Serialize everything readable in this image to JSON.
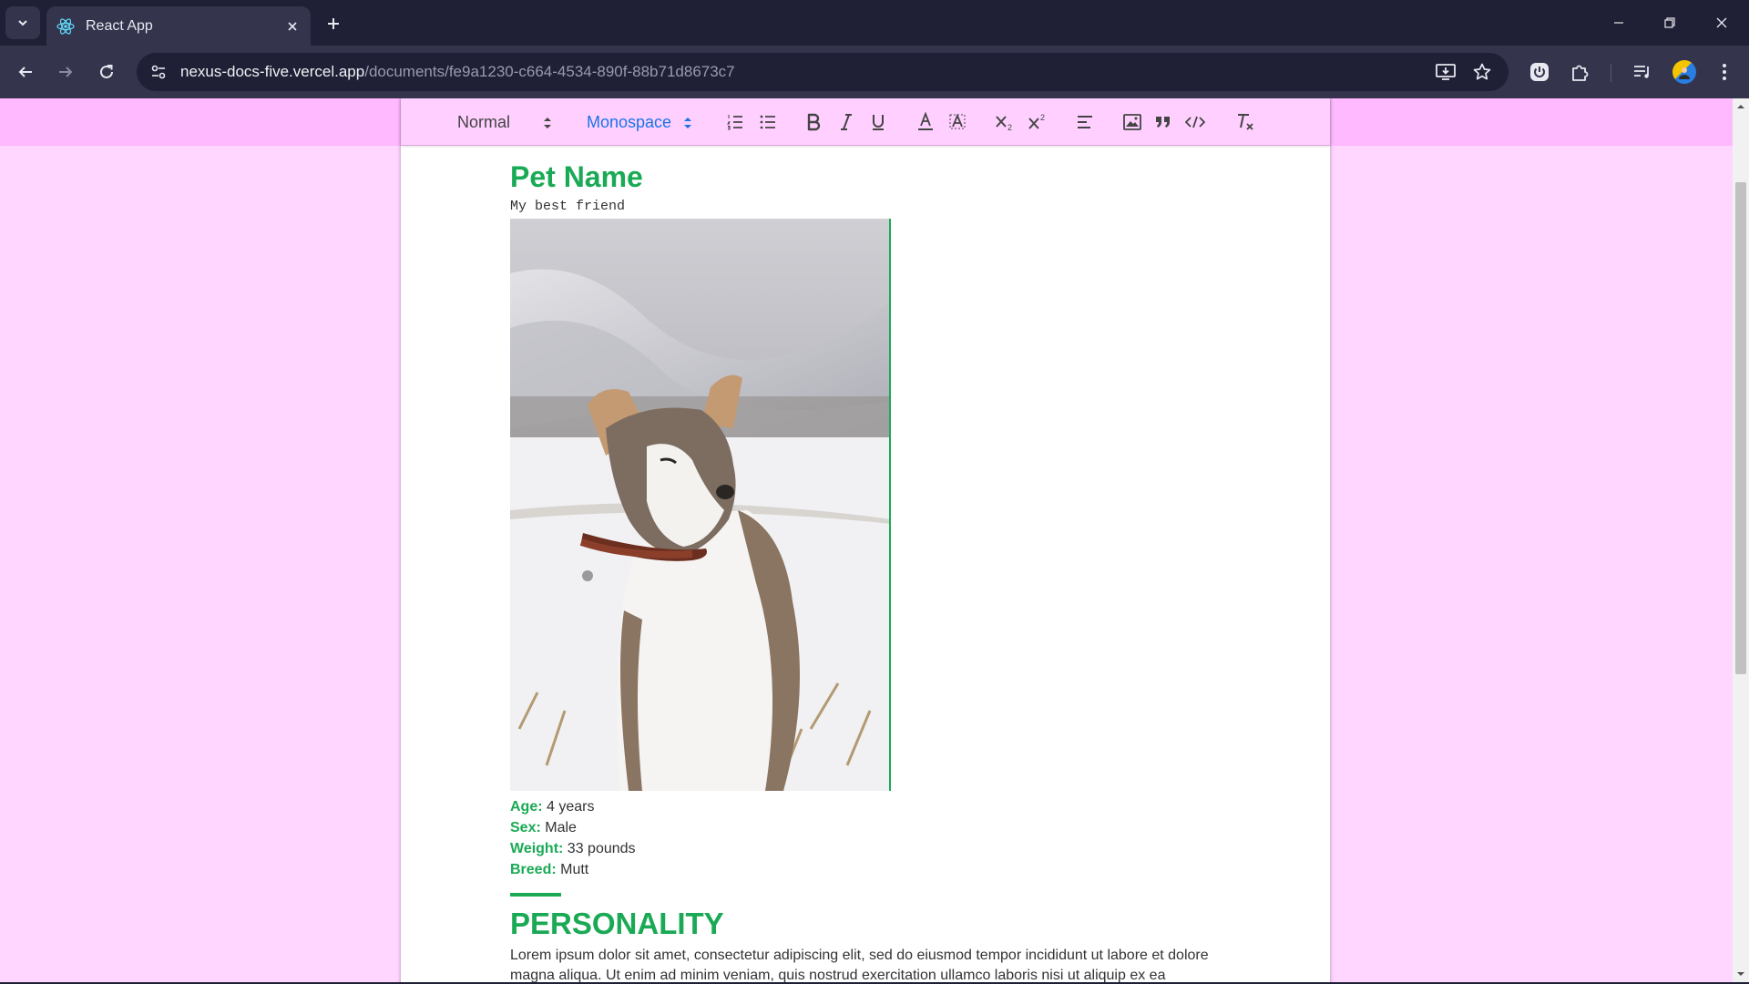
{
  "browser": {
    "tab_title": "React App",
    "url_host": "nexus-docs-five.vercel.app",
    "url_path": "/documents/fe9a1230-c664-4534-890f-88b71d8673c7"
  },
  "editor_toolbar": {
    "header_picker": "Normal",
    "font_picker": "Monospace",
    "font_picker_color": "#1a73e8",
    "icons": [
      "ordered-list-icon",
      "bullet-list-icon",
      "bold-icon",
      "italic-icon",
      "underline-icon",
      "text-color-icon",
      "background-color-icon",
      "subscript-icon",
      "superscript-icon",
      "align-icon",
      "image-icon",
      "blockquote-icon",
      "code-block-icon",
      "clear-format-icon"
    ]
  },
  "document": {
    "title": "Pet Name",
    "subtitle": "My best friend",
    "photo_icon": "dog-photo",
    "facts": [
      {
        "label": "Age:",
        "value": " 4 years"
      },
      {
        "label": "Sex:",
        "value": " Male"
      },
      {
        "label": "Weight:",
        "value": " 33 pounds"
      },
      {
        "label": "Breed:",
        "value": " Mutt"
      }
    ],
    "section_title": "PERSONALITY",
    "paragraph": "Lorem ipsum dolor sit amet, consectetur adipiscing elit, sed do eiusmod tempor incididunt ut labore et dolore magna aliqua. Ut enim ad minim veniam, quis nostrud exercitation ullamco laboris nisi ut aliquip ex ea"
  },
  "colors": {
    "accent_green": "#1aaa55",
    "page_background": "#ffd6ff",
    "chrome_dark": "#1f1f35"
  }
}
